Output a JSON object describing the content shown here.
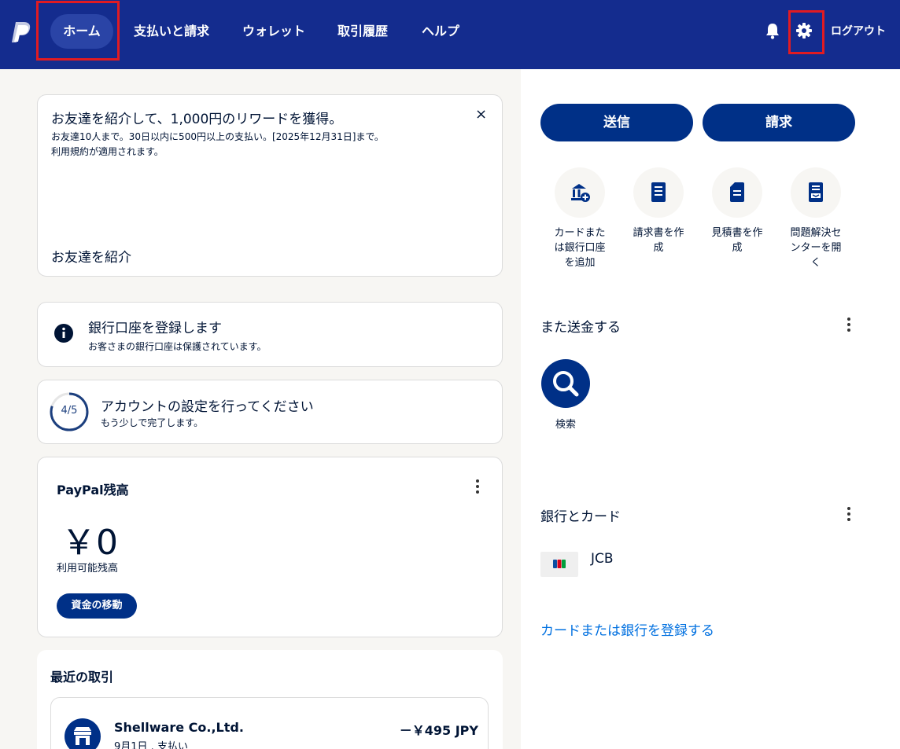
{
  "nav": {
    "items": [
      "ホーム",
      "支払いと請求",
      "ウォレット",
      "取引履歴",
      "ヘルプ"
    ],
    "logout": "ログアウト"
  },
  "promo": {
    "title": "お友達を紹介して、1,000円のリワードを獲得。",
    "body": "お友達10人まで。30日以内に500円以上の支払い。[2025年12月31日]まで。",
    "terms": "利用規約が適用されます。",
    "link": "お友達を紹介",
    "close": "×"
  },
  "bank": {
    "title": "銀行口座を登録します",
    "subtitle": "お客さまの銀行口座は保護されています。"
  },
  "setup": {
    "progress_text": "4/5",
    "progress": 0.8,
    "title": "アカウントの設定を行ってください",
    "subtitle": "もう少しで完了します。"
  },
  "balance": {
    "title": "PayPal残高",
    "amount": "￥0",
    "label": "利用可能残高",
    "button": "資金の移動"
  },
  "recent": {
    "title": "最近の取引",
    "transactions": [
      {
        "name": "Shellware Co.,Ltd.",
        "sub": "9月1日 . 支払い",
        "amount": "－￥495 JPY"
      }
    ]
  },
  "actions": {
    "send": "送信",
    "request": "請求"
  },
  "quick_actions": [
    {
      "label": "カードまたは銀行口座を追加",
      "icon": "bank-add-icon"
    },
    {
      "label": "請求書を作成",
      "icon": "invoice-icon"
    },
    {
      "label": "見積書を作成",
      "icon": "estimate-icon"
    },
    {
      "label": "問題解決センターを開く",
      "icon": "resolution-center-icon"
    }
  ],
  "send_again": {
    "title": "また送金する",
    "search_label": "検索"
  },
  "banks_cards": {
    "title": "銀行とカード",
    "card_name": "JCB",
    "add_link": "カードまたは銀行を登録する"
  },
  "colors": {
    "nav_bg": "#142c8e",
    "primary": "#003087",
    "link": "#0070e0",
    "highlight": "#e11b22"
  }
}
